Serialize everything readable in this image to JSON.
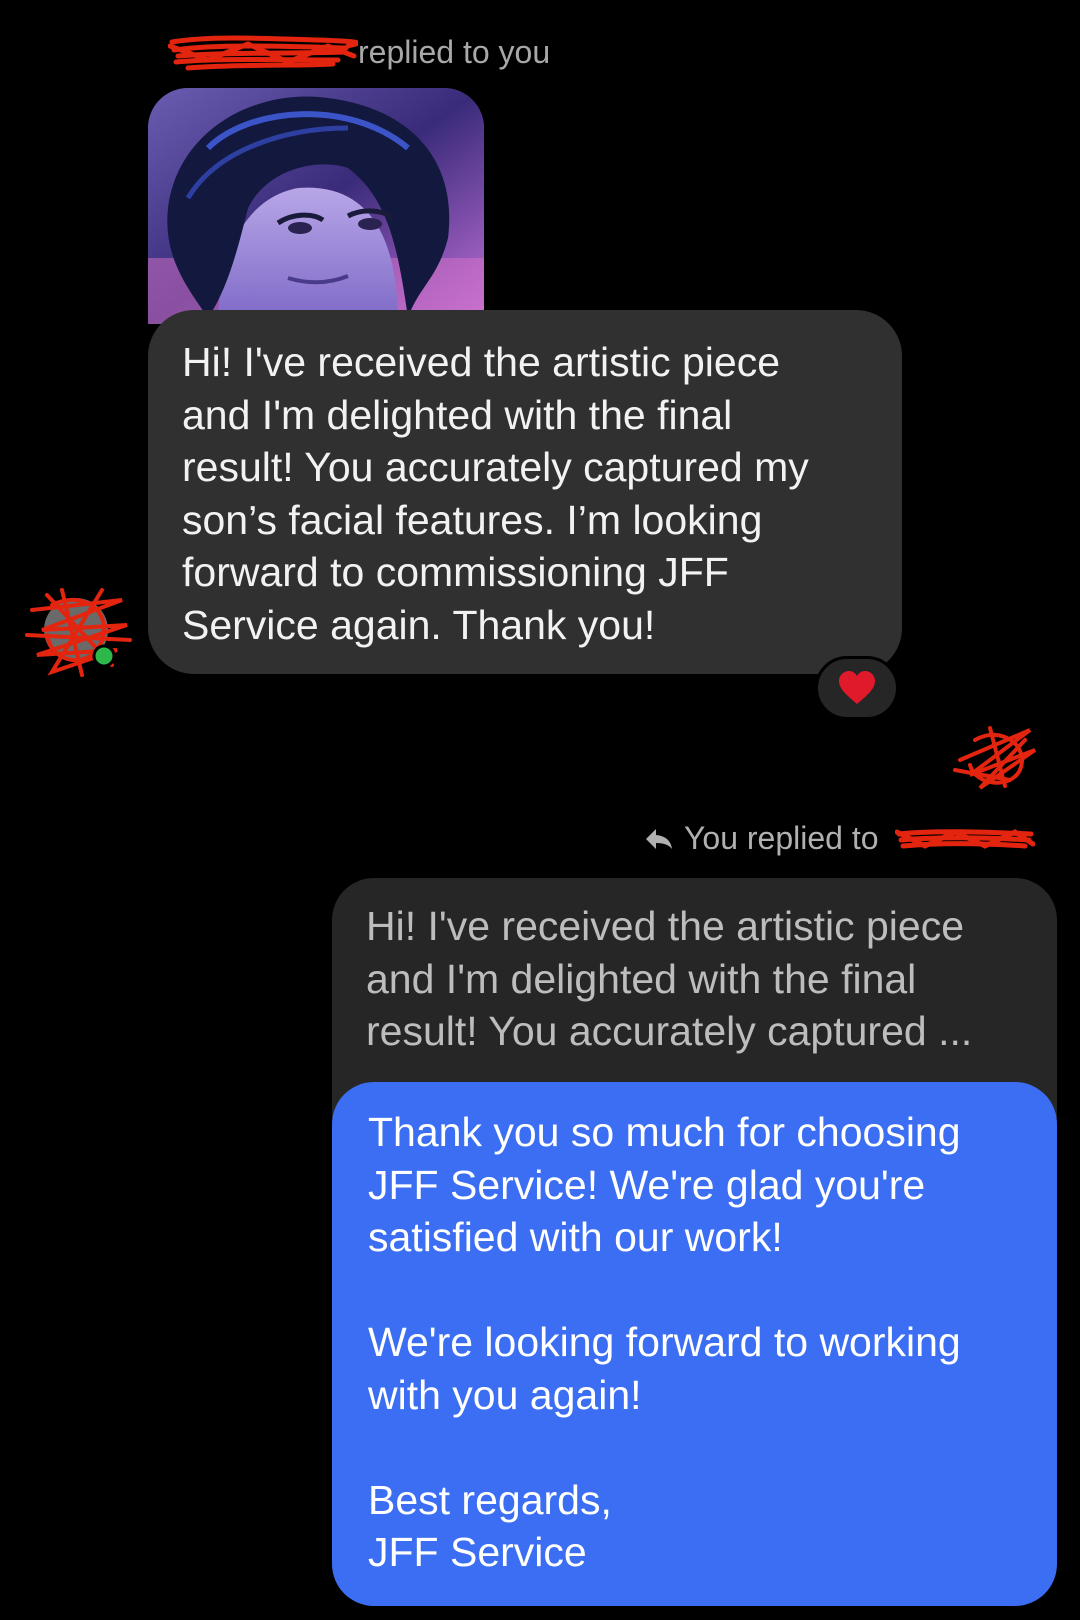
{
  "incoming": {
    "reply_header": "replied to you",
    "sender_name_redacted": true,
    "message": "Hi! I've received the artistic piece\nand I'm delighted with the final\nresult! You accurately captured my\nson’s facial features. I’m looking\nforward to commissioning JFF\nService again. Thank you!",
    "reaction": "heart-icon",
    "attachment": "artwork-thumbnail"
  },
  "outgoing": {
    "reply_header": "You replied to",
    "quoted_lines": [
      "Hi! I've received the artistic piece",
      "and I'm delighted with the final",
      "result! You accurately captured ..."
    ],
    "message": "Thank you so much for choosing\nJFF Service! We're glad you're\nsatisfied with our work!\n\nWe're looking forward to working\nwith you again!\n\nBest regards,\nJFF Service"
  },
  "colors": {
    "background": "#000000",
    "incoming_bubble": "#303030",
    "quoted_bubble": "#262626",
    "outgoing_bubble": "#3b6ef2",
    "redaction": "#e3240f",
    "reaction_heart": "#e0192b"
  }
}
